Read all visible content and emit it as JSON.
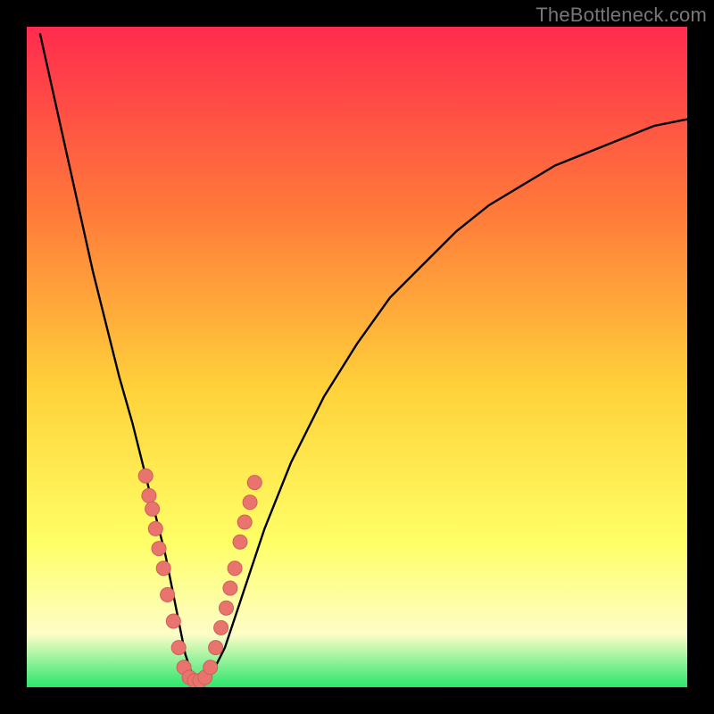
{
  "watermark": "TheBottleneck.com",
  "colors": {
    "frame": "#000000",
    "gradient_top": "#ff2b4e",
    "gradient_mid1": "#ff7a3a",
    "gradient_mid2": "#ffd23a",
    "gradient_mid3": "#ffff66",
    "gradient_low": "#fdfdc8",
    "gradient_bottom": "#2ae66b",
    "curve": "#000000",
    "marker_fill": "#e9746e",
    "marker_stroke": "#cf5f5a"
  },
  "chart_data": {
    "type": "line",
    "title": "",
    "xlabel": "",
    "ylabel": "",
    "xlim": [
      0,
      100
    ],
    "ylim": [
      0,
      100
    ],
    "grid": false,
    "legend": false,
    "series": [
      {
        "name": "bottleneck-curve",
        "x": [
          2,
          4,
          6,
          8,
          10,
          12,
          14,
          16,
          18,
          19,
          20,
          21,
          22,
          23,
          24,
          25,
          26,
          27,
          28,
          30,
          32,
          34,
          36,
          40,
          45,
          50,
          55,
          60,
          65,
          70,
          75,
          80,
          85,
          90,
          95,
          100
        ],
        "y": [
          99,
          90,
          81,
          72,
          63,
          55,
          47,
          40,
          32,
          28,
          24,
          20,
          15,
          10,
          5,
          2,
          1,
          1,
          2,
          6,
          12,
          18,
          24,
          34,
          44,
          52,
          59,
          64,
          69,
          73,
          76,
          79,
          81,
          83,
          85,
          86
        ]
      }
    ],
    "markers": [
      {
        "x": 18.0,
        "y": 32
      },
      {
        "x": 18.5,
        "y": 29
      },
      {
        "x": 19.0,
        "y": 27
      },
      {
        "x": 19.5,
        "y": 24
      },
      {
        "x": 20.0,
        "y": 21
      },
      {
        "x": 20.7,
        "y": 18
      },
      {
        "x": 21.3,
        "y": 14
      },
      {
        "x": 22.2,
        "y": 10
      },
      {
        "x": 23.0,
        "y": 6
      },
      {
        "x": 23.8,
        "y": 3
      },
      {
        "x": 24.6,
        "y": 1.5
      },
      {
        "x": 25.4,
        "y": 1
      },
      {
        "x": 26.2,
        "y": 1
      },
      {
        "x": 27.0,
        "y": 1.5
      },
      {
        "x": 27.8,
        "y": 3
      },
      {
        "x": 28.6,
        "y": 6
      },
      {
        "x": 29.4,
        "y": 9
      },
      {
        "x": 30.2,
        "y": 12
      },
      {
        "x": 30.8,
        "y": 15
      },
      {
        "x": 31.5,
        "y": 18
      },
      {
        "x": 32.3,
        "y": 22
      },
      {
        "x": 33.0,
        "y": 25
      },
      {
        "x": 33.8,
        "y": 28
      },
      {
        "x": 34.5,
        "y": 31
      }
    ]
  }
}
